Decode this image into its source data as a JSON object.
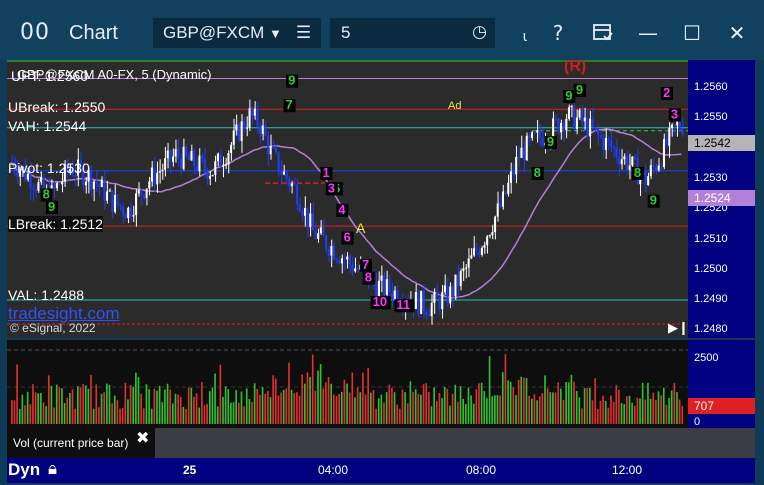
{
  "window": {
    "title": "Chart",
    "symbol": "GBP@FXCM",
    "interval": "5",
    "buttons": {
      "help": "?",
      "minimize": "—",
      "maximize": "☐",
      "close": "✕"
    }
  },
  "chart": {
    "header_text": "GBP@FXCM A0-FX, 5 (Dynamic)",
    "watermark": "tradesight.com",
    "copyright": "© eSignal, 2022",
    "annotation_ad": "Ad",
    "annotation_r": "(R)",
    "annotation_a": "A",
    "levels": {
      "upt": "UPT: 1.2560",
      "ubreak": "UBreak: 1.2550",
      "vah": "VAH: 1.2544",
      "pivot": "Pivot: 1.2530",
      "lbreak": "LBreak: 1.2512",
      "val": "VAL: 1.2488"
    },
    "price_ticks": [
      "1.2560",
      "1.2550",
      "1.2530",
      "1.2520",
      "1.2510",
      "1.2500",
      "1.2490",
      "1.2480"
    ],
    "price_badges": {
      "last": "1.2542",
      "vwap": "1.2524"
    },
    "volume_ticks": {
      "top": "2500",
      "zero": "0"
    },
    "volume_badge": "707",
    "volume_label": "Vol (current price bar)",
    "time_ticks": [
      "25",
      "04:00",
      "08:00",
      "12:00"
    ],
    "dyn_label": "Dyn",
    "colors": {
      "bull": "#ffffff",
      "bear": "#1e3cff",
      "avg_line": "#b47fd8",
      "setup": "#ff33ff",
      "countdown": "#33cc33"
    }
  },
  "chart_data": {
    "type": "candlestick",
    "y_range": [
      1.2475,
      1.2566
    ],
    "reference_lines": [
      1.256,
      1.255,
      1.2544,
      1.253,
      1.2512,
      1.2488
    ],
    "volume_range": [
      0,
      2500
    ],
    "waypoints": [
      [
        0,
        1.2533
      ],
      [
        8,
        1.2527
      ],
      [
        14,
        1.2521
      ],
      [
        22,
        1.2531
      ],
      [
        30,
        1.2528
      ],
      [
        38,
        1.252
      ],
      [
        44,
        1.2517
      ],
      [
        52,
        1.2527
      ],
      [
        62,
        1.2535
      ],
      [
        70,
        1.2532
      ],
      [
        76,
        1.253
      ],
      [
        82,
        1.2537
      ],
      [
        86,
        1.2543
      ],
      [
        90,
        1.2548
      ],
      [
        94,
        1.2545
      ],
      [
        98,
        1.2536
      ],
      [
        102,
        1.253
      ],
      [
        108,
        1.2523
      ],
      [
        114,
        1.251
      ],
      [
        120,
        1.2506
      ],
      [
        128,
        1.25
      ],
      [
        138,
        1.2493
      ],
      [
        146,
        1.249
      ],
      [
        152,
        1.2488
      ],
      [
        158,
        1.2486
      ],
      [
        166,
        1.249
      ],
      [
        172,
        1.2498
      ],
      [
        180,
        1.251
      ],
      [
        186,
        1.252
      ],
      [
        192,
        1.2535
      ],
      [
        198,
        1.254
      ],
      [
        204,
        1.2543
      ],
      [
        210,
        1.2548
      ],
      [
        216,
        1.2546
      ],
      [
        222,
        1.2541
      ],
      [
        228,
        1.2537
      ],
      [
        234,
        1.2532
      ],
      [
        240,
        1.2527
      ],
      [
        246,
        1.2535
      ],
      [
        252,
        1.2545
      ]
    ],
    "setup_counts": [
      {
        "bar": 118,
        "price": 1.2528,
        "text": "1"
      },
      {
        "bar": 120,
        "price": 1.2523,
        "text": "3"
      },
      {
        "bar": 124,
        "price": 1.2516,
        "text": "4"
      },
      {
        "bar": 126,
        "price": 1.2507,
        "text": "6"
      },
      {
        "bar": 133,
        "price": 1.2498,
        "text": "7"
      },
      {
        "bar": 134,
        "price": 1.2494,
        "text": "8"
      },
      {
        "bar": 137,
        "price": 1.2486,
        "text": "10"
      },
      {
        "bar": 146,
        "price": 1.2485,
        "text": "11"
      },
      {
        "bar": 247,
        "price": 1.2554,
        "text": "2"
      },
      {
        "bar": 250,
        "price": 1.2547,
        "text": "3"
      }
    ],
    "countdown_counts": [
      {
        "bar": 104,
        "price": 1.255,
        "text": "7"
      },
      {
        "bar": 105,
        "price": 1.2558,
        "text": "9"
      },
      {
        "bar": 122,
        "price": 1.2523,
        "text": "6"
      },
      {
        "bar": 198,
        "price": 1.2528,
        "text": "8"
      },
      {
        "bar": 203,
        "price": 1.2538,
        "text": "9"
      },
      {
        "bar": 210,
        "price": 1.2553,
        "text": "9"
      },
      {
        "bar": 214,
        "price": 1.2555,
        "text": "9"
      },
      {
        "bar": 236,
        "price": 1.2528,
        "text": "8"
      },
      {
        "bar": 242,
        "price": 1.2519,
        "text": "9"
      },
      {
        "bar": 12,
        "price": 1.2521,
        "text": "8"
      },
      {
        "bar": 14,
        "price": 1.2517,
        "text": "9"
      }
    ]
  }
}
